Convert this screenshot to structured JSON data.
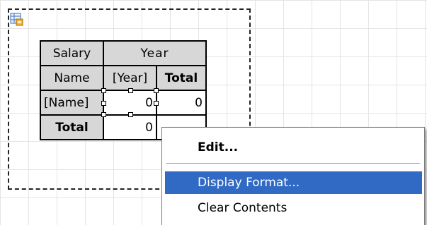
{
  "matrix": {
    "corner_label": "Salary",
    "column_group_label": "Year",
    "row_group_label": "Name",
    "column_field": "[Year]",
    "column_total_label": "Total",
    "row_field": "[Name]",
    "data_value": "0",
    "data_total_value": "0",
    "row_total_label": "Total",
    "row_total_value": "0"
  },
  "context_menu": {
    "items": [
      {
        "label": "Edit...",
        "bold": true
      },
      {
        "label": "Display Format...",
        "highlighted": true
      },
      {
        "label": "Clear Contents"
      }
    ]
  },
  "icons": {
    "matrix_icon": "matrix-report-icon"
  },
  "colors": {
    "menu_highlight": "#316ac5",
    "header_fill": "#d7d7d7"
  }
}
